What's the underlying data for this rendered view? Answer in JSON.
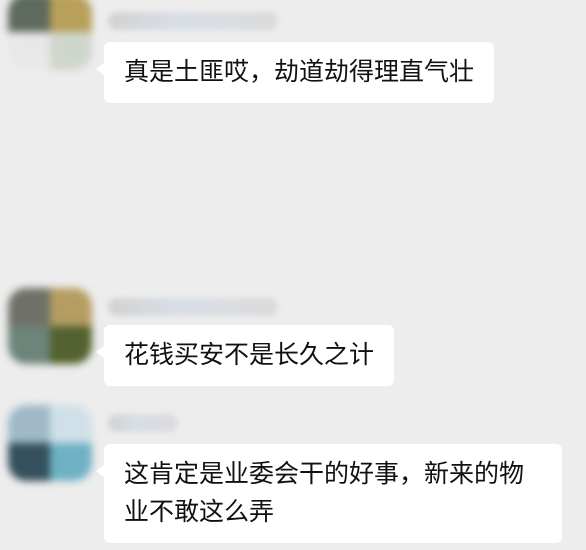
{
  "messages": [
    {
      "sender_name": "",
      "text": "真是土匪哎，劫道劫得理直气壮",
      "avatar_colors": [
        "#5e6a5e",
        "#b8a05a",
        "#e8e8e8",
        "#cfd6cc"
      ]
    },
    {
      "sender_name": "",
      "text": "花钱买安不是长久之计",
      "avatar_colors": [
        "#6f7068",
        "#b59d62",
        "#6c8479",
        "#53622f"
      ]
    },
    {
      "sender_name": "",
      "text": "这肯定是业委会干的好事，新来的物业不敢这么弄",
      "avatar_colors": [
        "#9fb9c6",
        "#cfe0e8",
        "#34505c",
        "#6fb1c4"
      ]
    }
  ],
  "colors": {
    "chat_background": "#ededed",
    "bubble_background": "#ffffff",
    "bubble_text": "#111111"
  }
}
